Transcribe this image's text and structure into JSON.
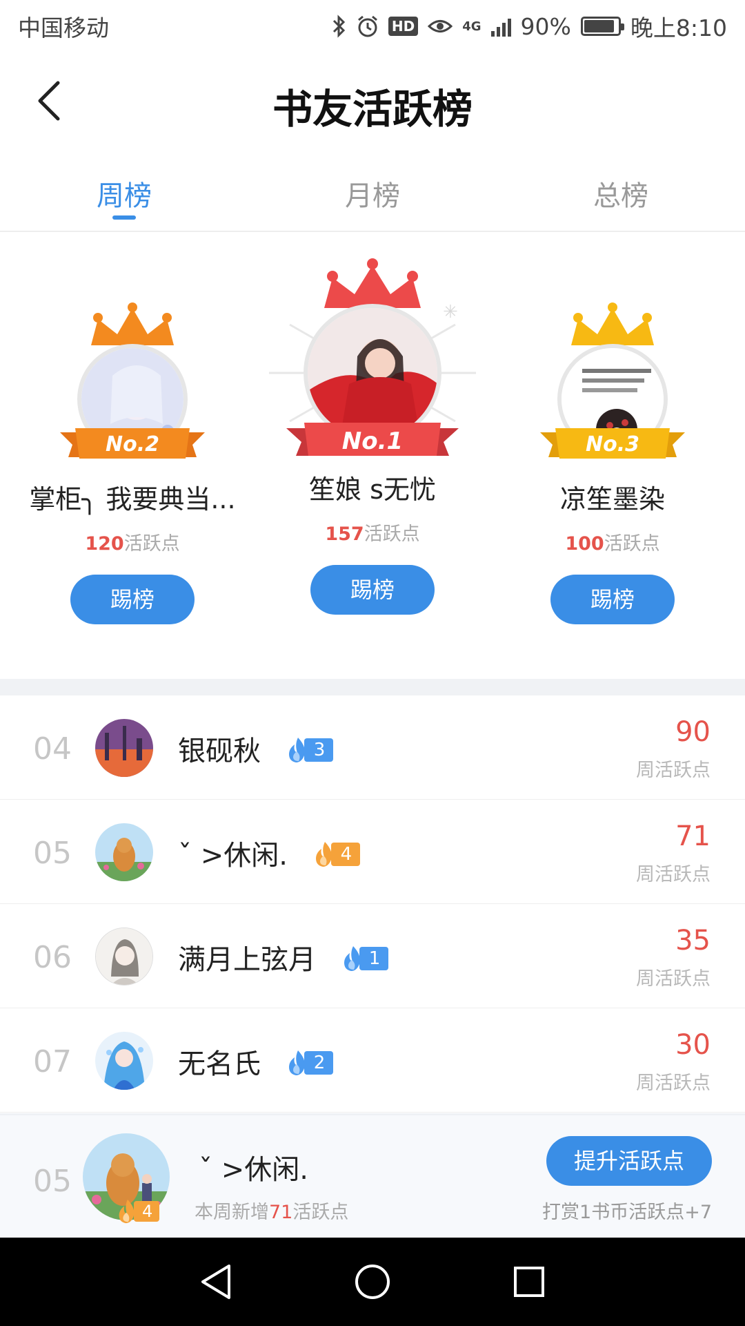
{
  "status_bar": {
    "carrier": "中国移动",
    "network": "4G",
    "battery": "90%",
    "battery_level": 0.9,
    "time": "晚上8:10",
    "hd": "HD"
  },
  "header": {
    "title": "书友活跃榜"
  },
  "tabs": [
    {
      "label": "周榜",
      "active": true
    },
    {
      "label": "月榜",
      "active": false
    },
    {
      "label": "总榜",
      "active": false
    }
  ],
  "podium": {
    "first": {
      "badge": "No.1",
      "name": "笙娘 s无忧",
      "points": "157",
      "points_label": "活跃点",
      "button": "踢榜"
    },
    "second": {
      "badge": "No.2",
      "name": "掌柜╮ 我要典当...",
      "points": "120",
      "points_label": "活跃点",
      "button": "踢榜"
    },
    "third": {
      "badge": "No.3",
      "name": "凉笙墨染",
      "points": "100",
      "points_label": "活跃点",
      "button": "踢榜"
    }
  },
  "ranking": [
    {
      "rank": "04",
      "name": "银砚秋",
      "level": "3",
      "level_color": "#4a9af0",
      "points": "90",
      "points_label": "周活跃点"
    },
    {
      "rank": "05",
      "name": "ˇ >休闲.",
      "level": "4",
      "level_color": "#f5a23a",
      "points": "71",
      "points_label": "周活跃点"
    },
    {
      "rank": "06",
      "name": "满月上弦月",
      "level": "1",
      "level_color": "#4a9af0",
      "points": "35",
      "points_label": "周活跃点"
    },
    {
      "rank": "07",
      "name": "无名氏",
      "level": "2",
      "level_color": "#4a9af0",
      "points": "30",
      "points_label": "周活跃点"
    }
  ],
  "my_rank": {
    "rank": "05",
    "name": "ˇ >休闲.",
    "level": "4",
    "weekly_prefix": "本周新增",
    "weekly_points": "71",
    "weekly_suffix": "活跃点",
    "button": "提升活跃点",
    "tip": "打赏1书币活跃点+7"
  },
  "colors": {
    "accent": "#3a8ee6",
    "points": "#e5534b",
    "gold": "#f3a21a",
    "first_red": "#ec4a4a",
    "second_orange": "#f38a1f"
  }
}
